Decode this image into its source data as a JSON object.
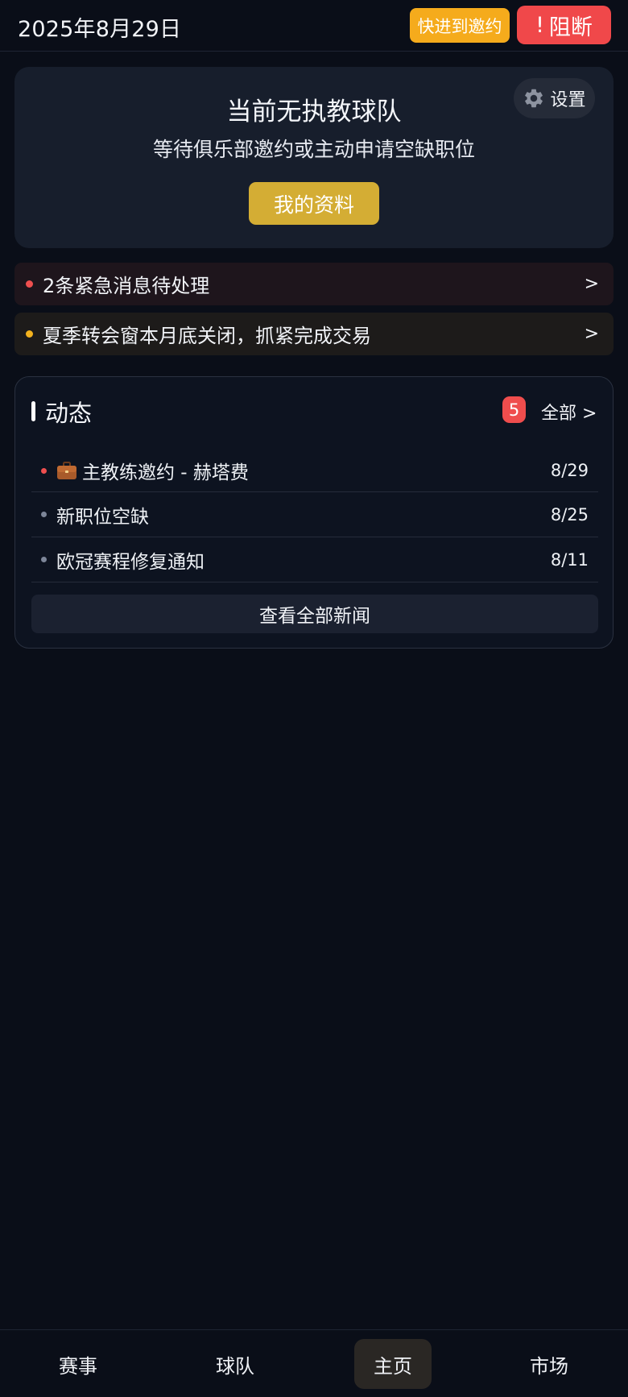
{
  "header": {
    "date": "2025年8月29日",
    "skip_button": "快进到邀约",
    "block_icon": "!",
    "block_button": "阻断"
  },
  "status_card": {
    "settings_label": "设置",
    "title": "当前无执教球队",
    "subtitle": "等待俱乐部邀约或主动申请空缺职位",
    "profile_button": "我的资料"
  },
  "alerts": [
    {
      "text": "2条紧急消息待处理",
      "chevron": ">",
      "color": "#ef4f4f"
    },
    {
      "text": "夏季转会窗本月底关闭，抓紧完成交易",
      "chevron": ">",
      "color": "#f3b21e"
    }
  ],
  "news": {
    "title": "动态",
    "count": "5",
    "all_label": "全部 >",
    "items": [
      {
        "text": "主教练邀约 - 赫塔费",
        "date": "8/29",
        "icon": "briefcase-icon"
      },
      {
        "text": "新职位空缺",
        "date": "8/25"
      },
      {
        "text": "欧冠赛程修复通知",
        "date": "8/11"
      }
    ],
    "view_all_button": "查看全部新闻"
  },
  "nav": {
    "items": [
      "赛事",
      "球队",
      "主页",
      "市场"
    ],
    "active": "主页"
  },
  "colors": {
    "background": "#0a0e18",
    "skip": "#f5ab1c",
    "block": "#f0484a",
    "profile": "#d4ad34",
    "badge": "#ef4d4d"
  }
}
